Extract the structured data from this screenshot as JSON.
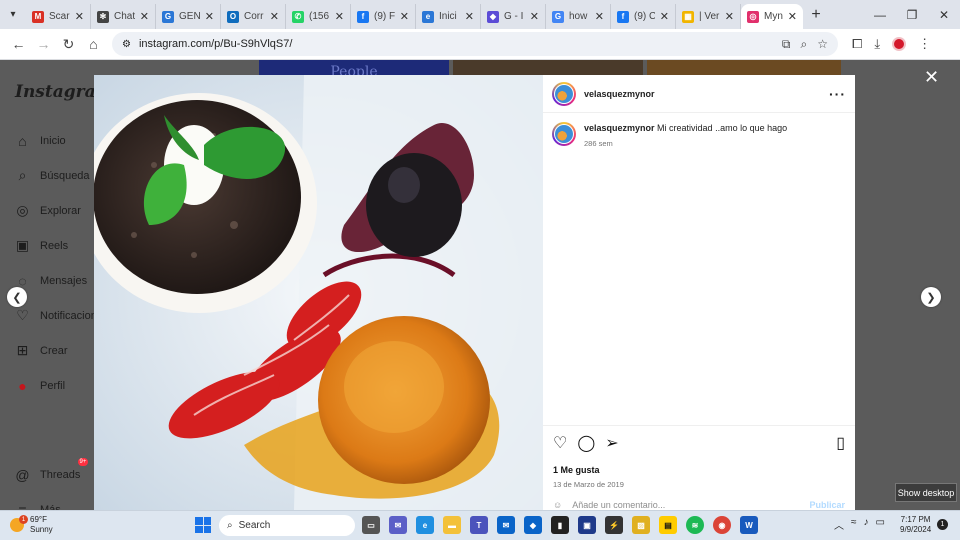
{
  "browser": {
    "tabs": [
      {
        "title": "Scar",
        "icon": "gmail-icon",
        "color": "#d93025",
        "glyph": "M"
      },
      {
        "title": "Chat",
        "icon": "chatgpt-icon",
        "color": "#444444",
        "glyph": "✻"
      },
      {
        "title": "GEN",
        "icon": "edge-copilot-icon",
        "color": "#2b77d6",
        "glyph": "G"
      },
      {
        "title": "Corr",
        "icon": "outlook-icon",
        "color": "#0f6cbd",
        "glyph": "O"
      },
      {
        "title": "(156",
        "icon": "whatsapp-icon",
        "color": "#25d366",
        "glyph": "✆"
      },
      {
        "title": "(9) F",
        "icon": "facebook-icon",
        "color": "#1877f2",
        "glyph": "f"
      },
      {
        "title": "Inici",
        "icon": "edge-icon",
        "color": "#2b77d6",
        "glyph": "e"
      },
      {
        "title": "G - I",
        "icon": "shield-icon",
        "color": "#5b4bd6",
        "glyph": "◆"
      },
      {
        "title": "how",
        "icon": "google-icon",
        "color": "#4285f4",
        "glyph": "G"
      },
      {
        "title": "(9) C",
        "icon": "facebook-icon",
        "color": "#1877f2",
        "glyph": "f"
      },
      {
        "title": "| Ver",
        "icon": "grid-icon",
        "color": "#f1b500",
        "glyph": "▦"
      },
      {
        "title": "Myn",
        "icon": "instagram-icon",
        "color": "#e1306c",
        "glyph": "◎",
        "active": true
      }
    ],
    "url": "instagram.com/p/Bu-S9hVlqS7/"
  },
  "instagram": {
    "logo": "Instagram",
    "nav": [
      {
        "label": "Inicio",
        "icon": "home-icon",
        "glyph": "⌂"
      },
      {
        "label": "Búsqueda",
        "icon": "search-icon",
        "glyph": "⌕"
      },
      {
        "label": "Explorar",
        "icon": "compass-icon",
        "glyph": "◎"
      },
      {
        "label": "Reels",
        "icon": "reels-icon",
        "glyph": "▣"
      },
      {
        "label": "Mensajes",
        "icon": "messenger-icon",
        "glyph": "◌"
      },
      {
        "label": "Notificaciones",
        "icon": "heart-icon",
        "glyph": "♡"
      },
      {
        "label": "Crear",
        "icon": "plus-square-icon",
        "glyph": "⊞"
      },
      {
        "label": "Perfil",
        "icon": "profile-icon",
        "glyph": "●"
      },
      {
        "label": "Threads",
        "icon": "threads-icon",
        "glyph": "@",
        "badge": "9+"
      },
      {
        "label": "Más",
        "icon": "menu-icon",
        "glyph": "≡"
      }
    ],
    "post": {
      "username": "velasquezmynor",
      "caption": "Mi creatividad ..amo lo que hago",
      "time_ago": "286 sem",
      "likes": "1 Me gusta",
      "date": "13 de Marzo de 2019",
      "comment_placeholder": "Añade un comentario...",
      "publish_label": "Publicar"
    },
    "background_text": "People"
  },
  "tooltip": "Show desktop",
  "taskbar": {
    "weather_temp": "69°F",
    "weather_desc": "Sunny",
    "weather_badge": "1",
    "search_placeholder": "Search",
    "time": "7:17 PM",
    "date": "9/9/2024",
    "notifications": "1"
  }
}
